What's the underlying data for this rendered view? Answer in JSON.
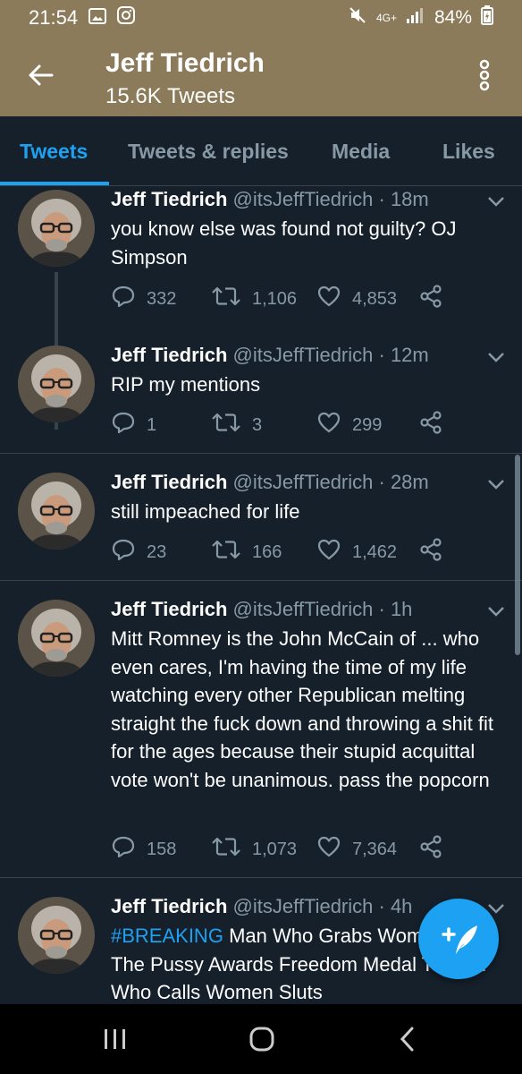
{
  "status_bar": {
    "time": "21:54",
    "network": "4G+",
    "battery": "84%"
  },
  "header": {
    "title": "Jeff Tiedrich",
    "subtitle": "15.6K Tweets"
  },
  "tabs": [
    {
      "label": "Tweets",
      "active": true
    },
    {
      "label": "Tweets & replies",
      "active": false
    },
    {
      "label": "Media",
      "active": false
    },
    {
      "label": "Likes",
      "active": false
    }
  ],
  "tweets": [
    {
      "name": "Jeff Tiedrich",
      "handle": "@itsJeffTiedrich",
      "time": "· 18m",
      "text": "you know else was found not guilty? OJ Simpson",
      "replies": "332",
      "retweets": "1,106",
      "likes": "4,853"
    },
    {
      "name": "Jeff Tiedrich",
      "handle": "@itsJeffTiedrich",
      "time": "· 12m",
      "text": "RIP my mentions",
      "replies": "1",
      "retweets": "3",
      "likes": "299"
    },
    {
      "name": "Jeff Tiedrich",
      "handle": "@itsJeffTiedrich",
      "time": "· 28m",
      "text": "still impeached for life",
      "replies": "23",
      "retweets": "166",
      "likes": "1,462"
    },
    {
      "name": "Jeff Tiedrich",
      "handle": "@itsJeffTiedrich",
      "time": "· 1h",
      "text": "Mitt Romney is the John McCain of ... who even cares, I'm having the time of my life watching every other Republican melting straight the fuck down and throwing a shit fit for the ages because their stupid acquittal vote won't be unanimous. pass the popcorn",
      "replies": "158",
      "retweets": "1,073",
      "likes": "7,364"
    },
    {
      "name": "Jeff Tiedrich",
      "handle": "@itsJeffTiedrich",
      "time": "· 4h",
      "hashtag": "#BREAKING",
      "text": "Man Who Grabs Women By The Pussy Awards Freedom Medal To Man Who Calls Women Sluts"
    }
  ],
  "colors": {
    "header_bg": "#8c7b5a",
    "background": "#15202b",
    "accent": "#1da1f2",
    "secondary_text": "#8899a6",
    "divider": "#38444d"
  },
  "icons": {
    "back": "arrow-left-icon",
    "more": "kebab-menu-icon",
    "reply": "speech-bubble-icon",
    "retweet": "retweet-icon",
    "like": "heart-icon",
    "share": "share-icon",
    "compose": "feather-plus-icon"
  }
}
